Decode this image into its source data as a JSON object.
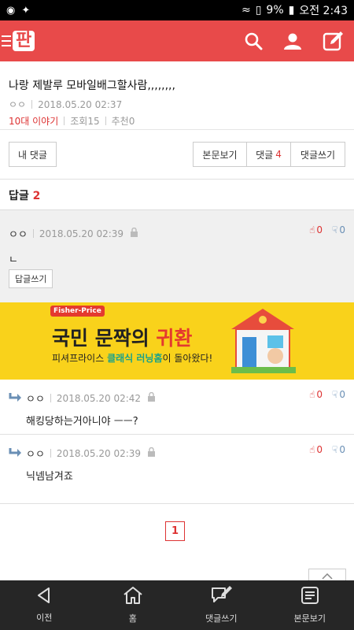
{
  "status": {
    "battery": "9%",
    "clock": "오전 2:43"
  },
  "header": {
    "logo_text": "판",
    "icons": [
      "search-icon",
      "user-icon",
      "write-icon"
    ]
  },
  "post": {
    "title": "나랑 제발루 모바일배그할사람,,,,,,,,",
    "nickname": "ㅇㅇ",
    "date": "2018.05.20 02:37",
    "category": "10대 이야기",
    "views": "조회15",
    "recommend": "추천0"
  },
  "buttons": {
    "my_comments": "내 댓글",
    "view_post": "본문보기",
    "comments_label": "댓글",
    "comments_count": "4",
    "write_comment": "댓글쓰기"
  },
  "replies": {
    "label": "답글",
    "count": "2"
  },
  "main_comment": {
    "nickname": "ㅇㅇ",
    "date": "2018.05.20 02:39",
    "text": "ㄴ",
    "up": "0",
    "down": "0",
    "reply_button": "답글쓰기"
  },
  "ad": {
    "brand": "Fisher-Price",
    "headline_prefix": "국민 문짝의 ",
    "headline_highlight": "귀환",
    "sub_prefix": "피셔프라이스 ",
    "sub_highlight": "클래식 러닝홈",
    "sub_suffix": "이 돌아왔다!",
    "accent": "#f9d21b"
  },
  "subcomments": [
    {
      "nickname": "ㅇㅇ",
      "date": "2018.05.20 02:42",
      "text": "해킹당하는거아니야 ㅡㅡ?",
      "up": "0",
      "down": "0"
    },
    {
      "nickname": "ㅇㅇ",
      "date": "2018.05.20 02:39",
      "text": "닉넴남겨죠",
      "up": "0",
      "down": "0"
    }
  ],
  "pagination": {
    "current": "1"
  },
  "bottom_nav": [
    {
      "label": "이전",
      "icon": "back-icon"
    },
    {
      "label": "홈",
      "icon": "home-icon"
    },
    {
      "label": "댓글쓰기",
      "icon": "write-comment-icon"
    },
    {
      "label": "본문보기",
      "icon": "article-icon"
    }
  ]
}
